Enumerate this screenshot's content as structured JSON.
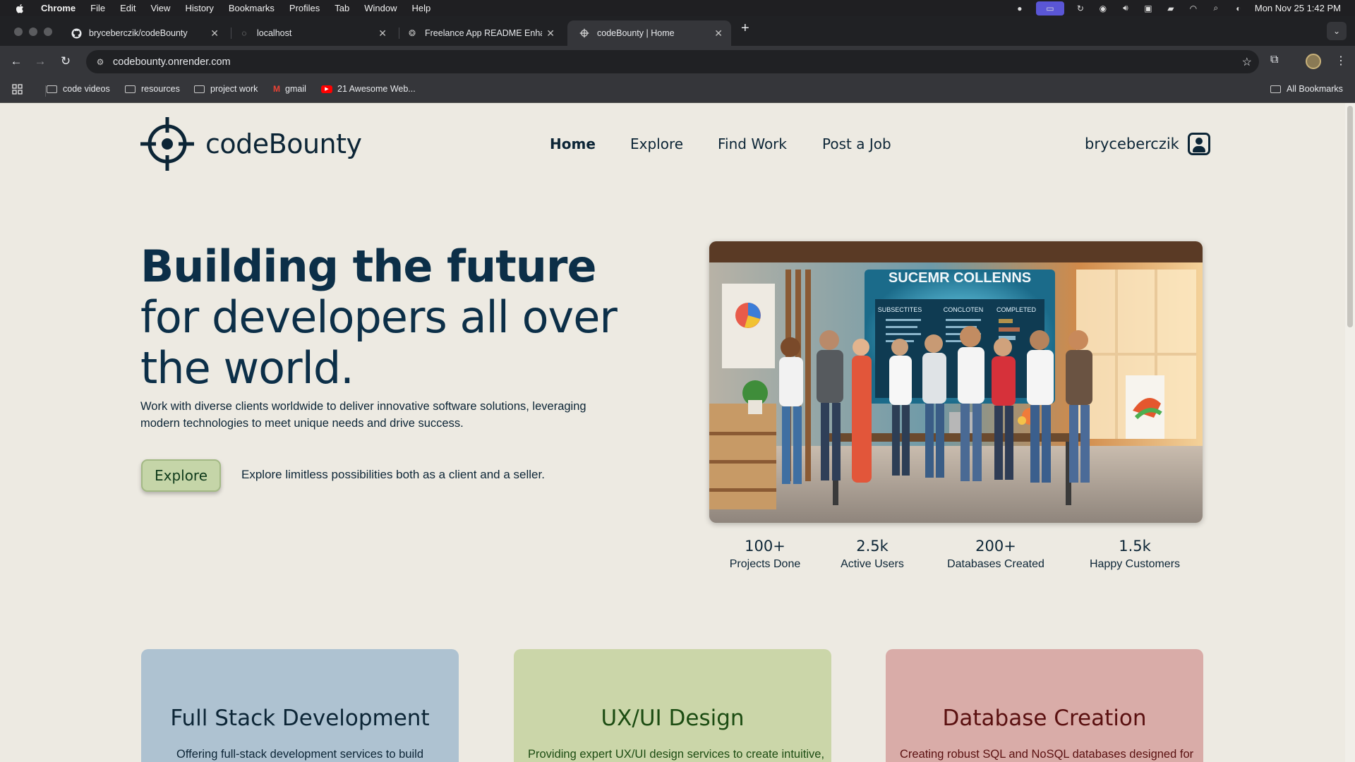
{
  "menubar": {
    "app": "Chrome",
    "items": [
      "File",
      "Edit",
      "View",
      "History",
      "Bookmarks",
      "Profiles",
      "Tab",
      "Window",
      "Help"
    ],
    "clock": "Mon Nov 25  1:42 PM"
  },
  "tabs": [
    {
      "title": "bryceberczik/codeBounty",
      "icon": "github-icon"
    },
    {
      "title": "localhost",
      "icon": "globe-icon"
    },
    {
      "title": "Freelance App README Enhancement",
      "icon": "chatgpt-icon"
    },
    {
      "title": "codeBounty | Home",
      "icon": "crosshair-icon"
    }
  ],
  "address": {
    "url": "codebounty.onrender.com"
  },
  "bookmarks": {
    "items": [
      "code videos",
      "resources",
      "project work",
      "gmail",
      "21 Awesome Web..."
    ],
    "all": "All Bookmarks"
  },
  "site": {
    "brand": "codeBounty",
    "nav": [
      "Home",
      "Explore",
      "Find Work",
      "Post a Job"
    ],
    "username": "bryceberczik",
    "hero": {
      "title_bold": "Building the future",
      "title_rest": " for developers all over the world.",
      "description": "Work with diverse clients worldwide to deliver innovative software solutions, leveraging modern technologies to meet unique needs and drive success.",
      "button": "Explore",
      "note": "Explore limitless possibilities both as a client and a seller.",
      "image_sign": "SUCEMR COLLENNS",
      "image_columns": [
        "SUBSECTITES",
        "CONCLOTEN",
        "COMPLETED"
      ]
    },
    "stats": [
      {
        "value": "100+",
        "label": "Projects Done"
      },
      {
        "value": "2.5k",
        "label": "Active Users"
      },
      {
        "value": "200+",
        "label": "Databases Created"
      },
      {
        "value": "1.5k",
        "label": "Happy Customers"
      }
    ],
    "cards": [
      {
        "title": "Full Stack Development",
        "description": "Offering full-stack development services to build",
        "bg": "#aec2d1",
        "color": "#0c2536"
      },
      {
        "title": "UX/UI Design",
        "description": "Providing expert UX/UI design services to create intuitive,",
        "bg": "#cbd6a9",
        "color": "#1c4c12"
      },
      {
        "title": "Database Creation",
        "description": "Creating robust SQL and NoSQL databases designed for",
        "bg": "#d9aca8",
        "color": "#5a1010"
      }
    ]
  },
  "colors": {
    "brand_dark": "#0c2536",
    "explore_green": "#c5d5a8",
    "page_bg": "#edeae2"
  }
}
